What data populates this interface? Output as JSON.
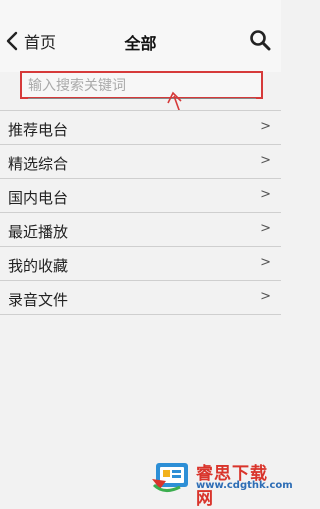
{
  "header": {
    "back_label": "首页",
    "title": "全部"
  },
  "search": {
    "placeholder": "输入搜索关键词"
  },
  "list": {
    "items": [
      {
        "label": "推荐电台",
        "chevron": ">"
      },
      {
        "label": "精选综合",
        "chevron": ">"
      },
      {
        "label": "国内电台",
        "chevron": ">"
      },
      {
        "label": "最近播放",
        "chevron": ">"
      },
      {
        "label": "我的收藏",
        "chevron": ">"
      },
      {
        "label": "录音文件",
        "chevron": ">"
      }
    ]
  },
  "watermark": {
    "title": "睿思下载网",
    "url": "www.cdgthk.com"
  },
  "colors": {
    "annotation_red": "#d63a3a",
    "watermark_red": "#d9342b",
    "watermark_blue": "#2d6db5"
  },
  "icons": {
    "back": "chevron-left-icon",
    "search": "search-icon"
  }
}
